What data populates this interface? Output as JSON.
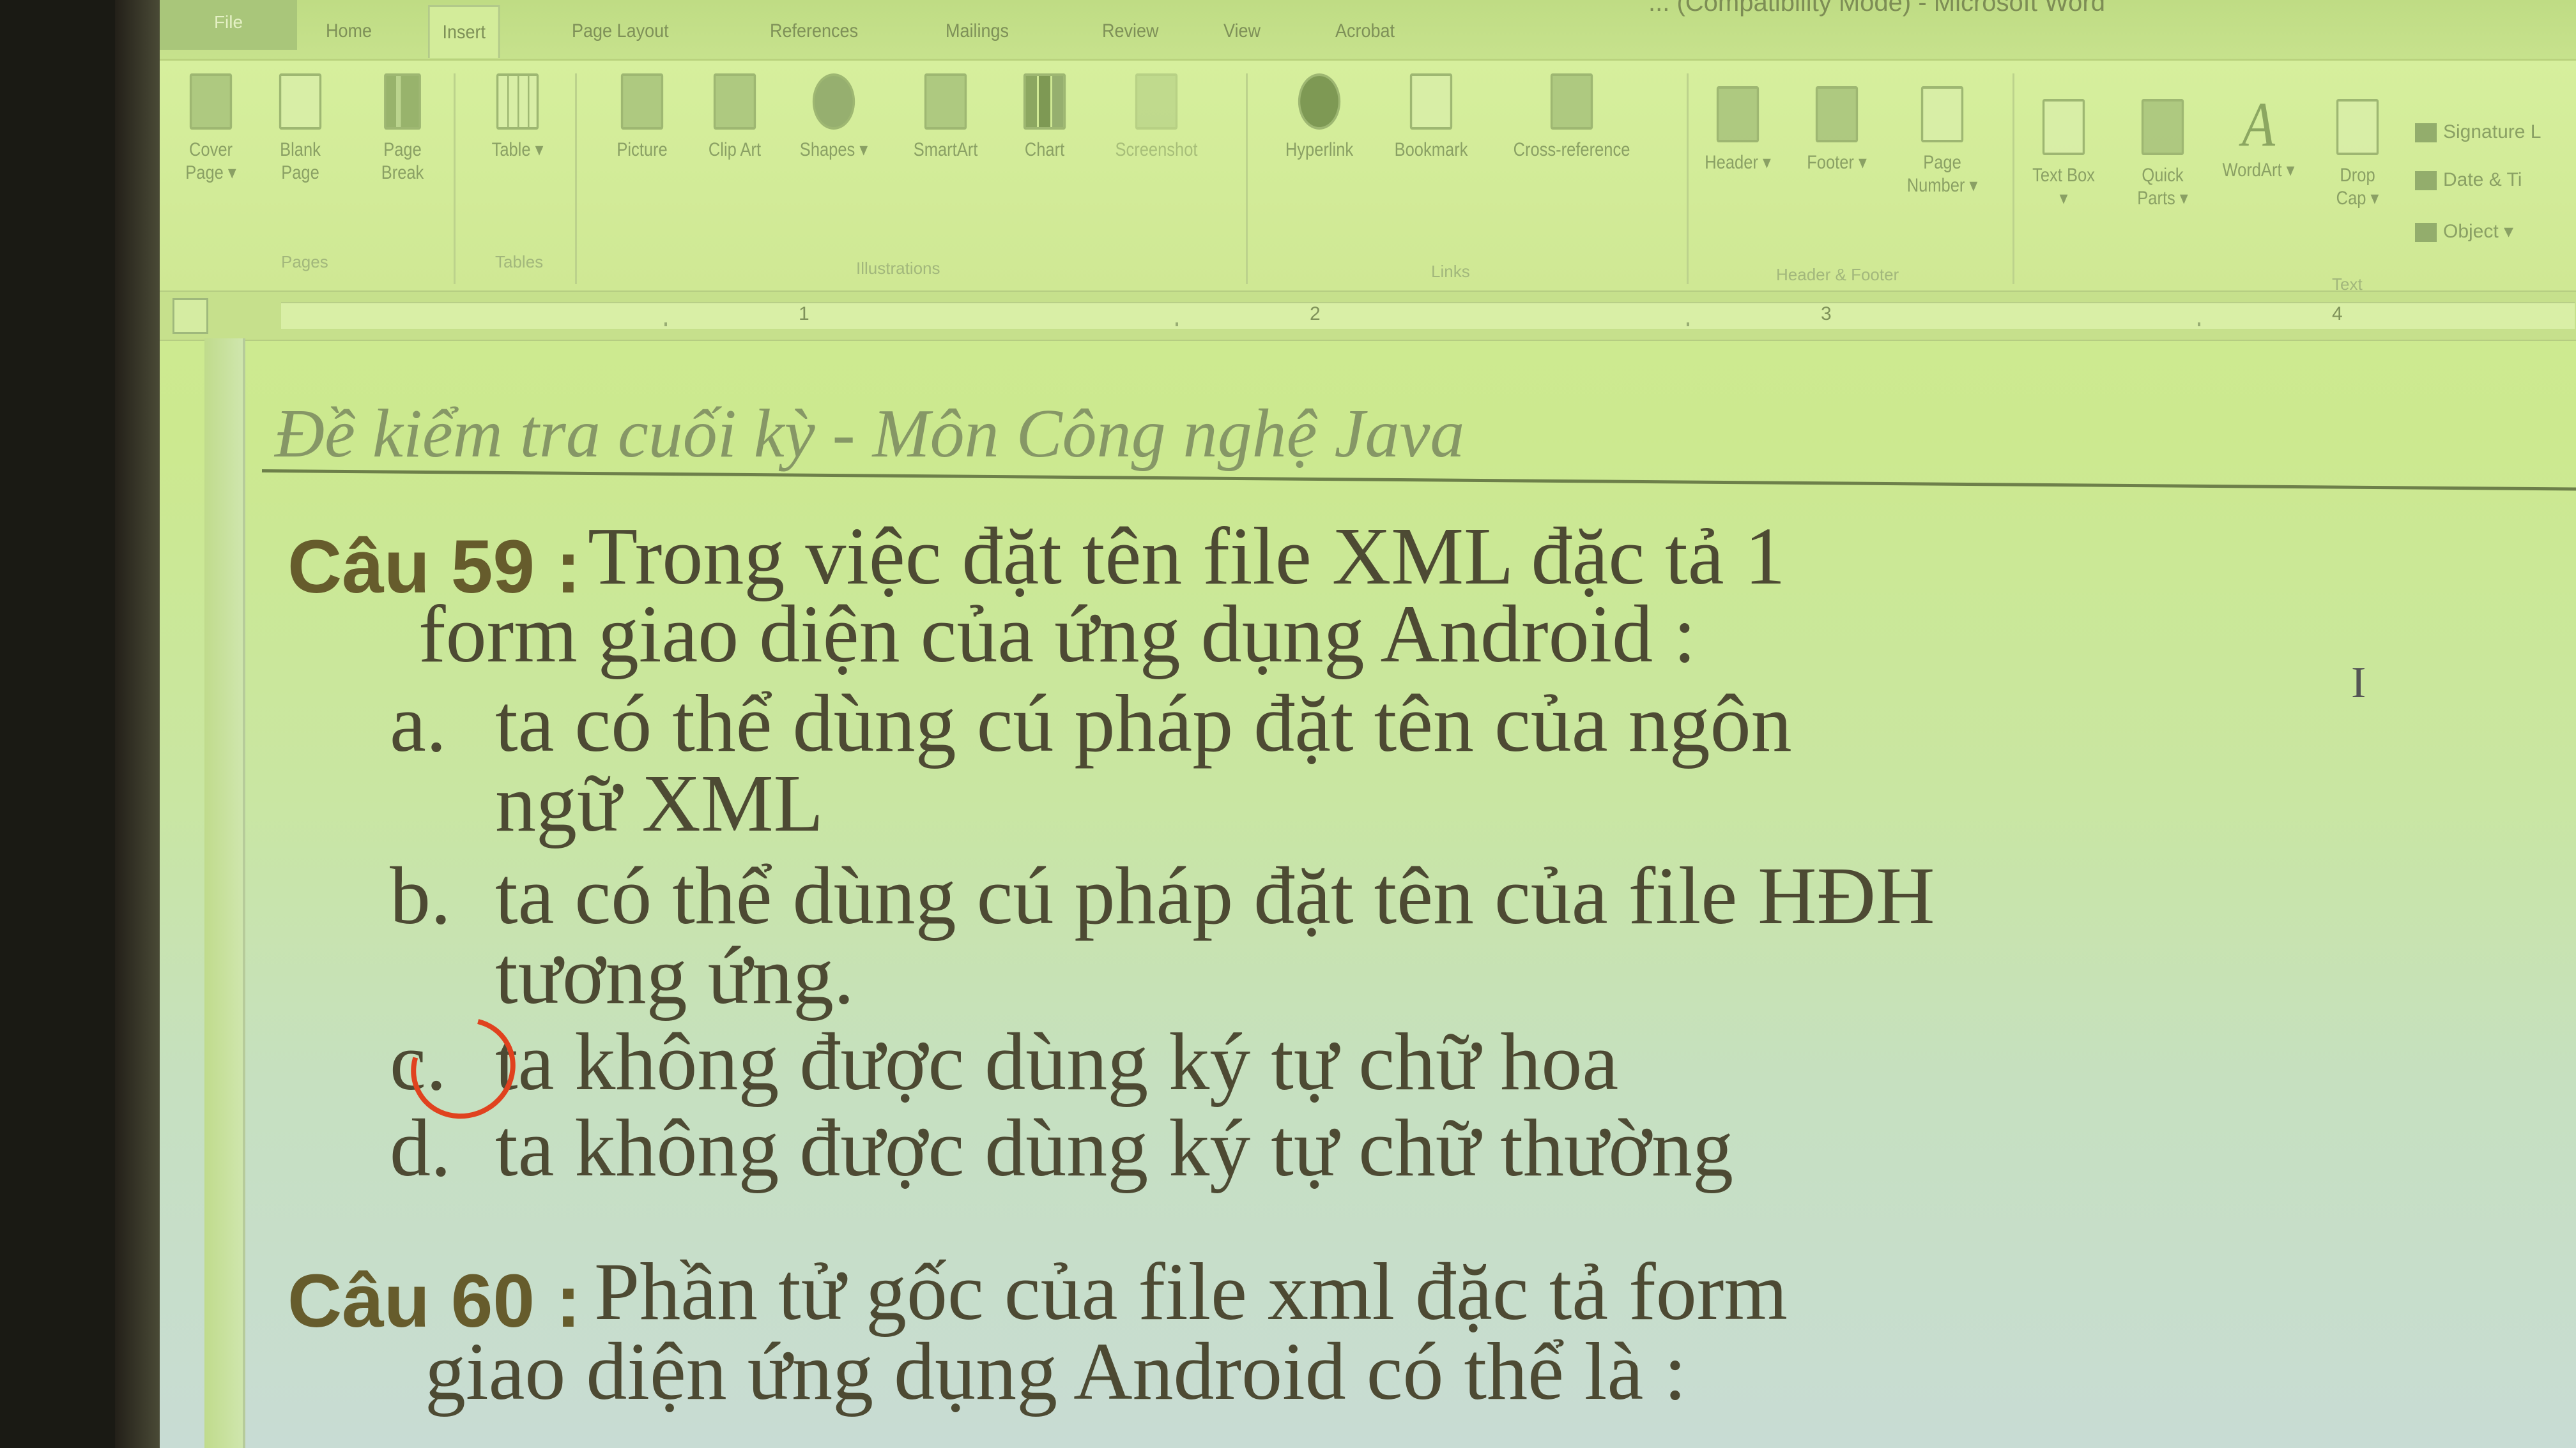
{
  "window": {
    "title": "... (Compatibility Mode) - Microsoft Word"
  },
  "tabs": {
    "file": "File",
    "items": [
      "Home",
      "Insert",
      "Page Layout",
      "References",
      "Mailings",
      "Review",
      "View",
      "Acrobat"
    ],
    "active": "Insert"
  },
  "ribbon": {
    "pages": {
      "group": "Pages",
      "cover_page": "Cover Page ▾",
      "blank_page": "Blank Page",
      "page_break": "Page Break"
    },
    "tables": {
      "group": "Tables",
      "table": "Table ▾"
    },
    "illustrations": {
      "group": "Illustrations",
      "picture": "Picture",
      "clip_art": "Clip Art",
      "shapes": "Shapes ▾",
      "smartart": "SmartArt",
      "chart": "Chart",
      "screenshot": "Screenshot"
    },
    "links": {
      "group": "Links",
      "hyperlink": "Hyperlink",
      "bookmark": "Bookmark",
      "cross_reference": "Cross-reference"
    },
    "header_footer": {
      "group": "Header & Footer",
      "header": "Header ▾",
      "footer": "Footer ▾",
      "page_number": "Page Number ▾"
    },
    "text": {
      "group": "Text",
      "text_box": "Text Box ▾",
      "quick_parts": "Quick Parts ▾",
      "wordart": "WordArt ▾",
      "drop_cap": "Drop Cap ▾",
      "signature": "Signature L",
      "date_time": "Date & Ti",
      "object": "Object ▾"
    }
  },
  "ruler": {
    "numbers": [
      "1",
      "2",
      "3",
      "4"
    ]
  },
  "document": {
    "header": "Đề kiểm tra cuối kỳ - Môn Công nghệ Java",
    "q59": {
      "label": "Câu 59 :",
      "line1": "Trong việc đặt tên file XML đặc tả 1",
      "line2": "form giao diện của ứng dụng Android :",
      "a_letter": "a.",
      "a_line1": "ta có thể dùng cú pháp đặt tên của ngôn",
      "a_line2": "ngữ XML",
      "b_letter": "b.",
      "b_line1": "ta có thể dùng cú pháp đặt tên của file HĐH",
      "b_line2": "tương ứng.",
      "c_letter": "c.",
      "c_line1": "ta không được dùng ký tự chữ hoa",
      "d_letter": "d.",
      "d_line1": "ta không được dùng ký tự chữ thường"
    },
    "q60": {
      "label": "Câu 60 :",
      "line1": "Phần tử gốc của file xml đặc tả form",
      "line2": "giao diện ứng dụng Android có thể là :"
    }
  },
  "colors": {
    "screen_tint": "#cfe894",
    "answer_mark": "#e0421f"
  }
}
